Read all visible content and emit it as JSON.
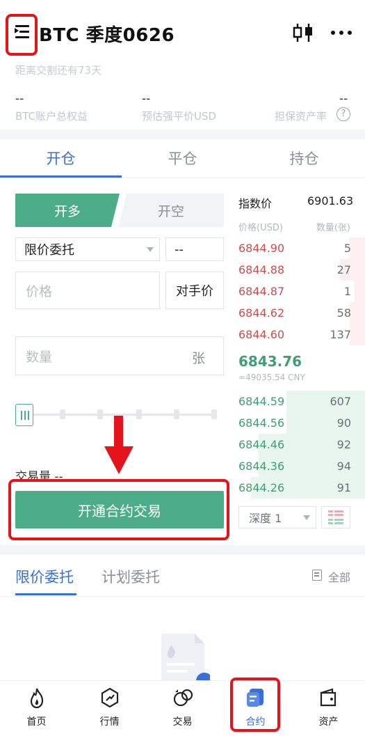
{
  "header": {
    "title": "BTC 季度0626",
    "subtitle": "距离交割还有73天"
  },
  "stats": [
    {
      "value": "--",
      "label": "BTC账户总权益"
    },
    {
      "value": "--",
      "label": "预估强平价USD"
    },
    {
      "value": "--",
      "label": "担保资产率"
    }
  ],
  "tabs": [
    "开仓",
    "平仓",
    "持仓"
  ],
  "form": {
    "open_long": "开多",
    "open_short": "开空",
    "order_type": "限价委托",
    "small_value": "--",
    "price_placeholder": "价格",
    "counter_price": "对手价",
    "qty_placeholder": "数量",
    "qty_unit": "张",
    "volume_label": "交易量 --",
    "submit": "开通合约交易"
  },
  "orderbook": {
    "index_label": "指数价",
    "index_value": "6901.63",
    "col_price": "价格(USD)",
    "col_qty": "数量(张)",
    "asks": [
      {
        "price": "6844.90",
        "qty": "5",
        "depth": 0.12
      },
      {
        "price": "6844.88",
        "qty": "27",
        "depth": 0.2
      },
      {
        "price": "6844.87",
        "qty": "1",
        "depth": 0.08
      },
      {
        "price": "6844.62",
        "qty": "58",
        "depth": 0.12
      },
      {
        "price": "6844.60",
        "qty": "137",
        "depth": 0.12
      }
    ],
    "last_price": "6843.76",
    "last_cny": "≈49035.54 CNY",
    "bids": [
      {
        "price": "6844.59",
        "qty": "607",
        "depth": 0.62
      },
      {
        "price": "6844.56",
        "qty": "90",
        "depth": 0.62
      },
      {
        "price": "6844.46",
        "qty": "92",
        "depth": 0.84
      },
      {
        "price": "6844.36",
        "qty": "94",
        "depth": 0.84
      },
      {
        "price": "6844.26",
        "qty": "91",
        "depth": 0.9
      }
    ],
    "depth_select": "深度 1"
  },
  "orders": {
    "tabs": [
      "限价委托",
      "计划委托"
    ],
    "all_label": "全部"
  },
  "bottom_nav": [
    {
      "label": "首页",
      "icon": "fire-icon"
    },
    {
      "label": "行情",
      "icon": "market-icon"
    },
    {
      "label": "交易",
      "icon": "trade-icon"
    },
    {
      "label": "合约",
      "icon": "contract-icon",
      "active": true
    },
    {
      "label": "资产",
      "icon": "wallet-icon"
    }
  ],
  "colors": {
    "accent": "#3a6fd8",
    "buy": "#4ead89",
    "sell": "#d14b4b",
    "highlight": "#e5141b"
  }
}
